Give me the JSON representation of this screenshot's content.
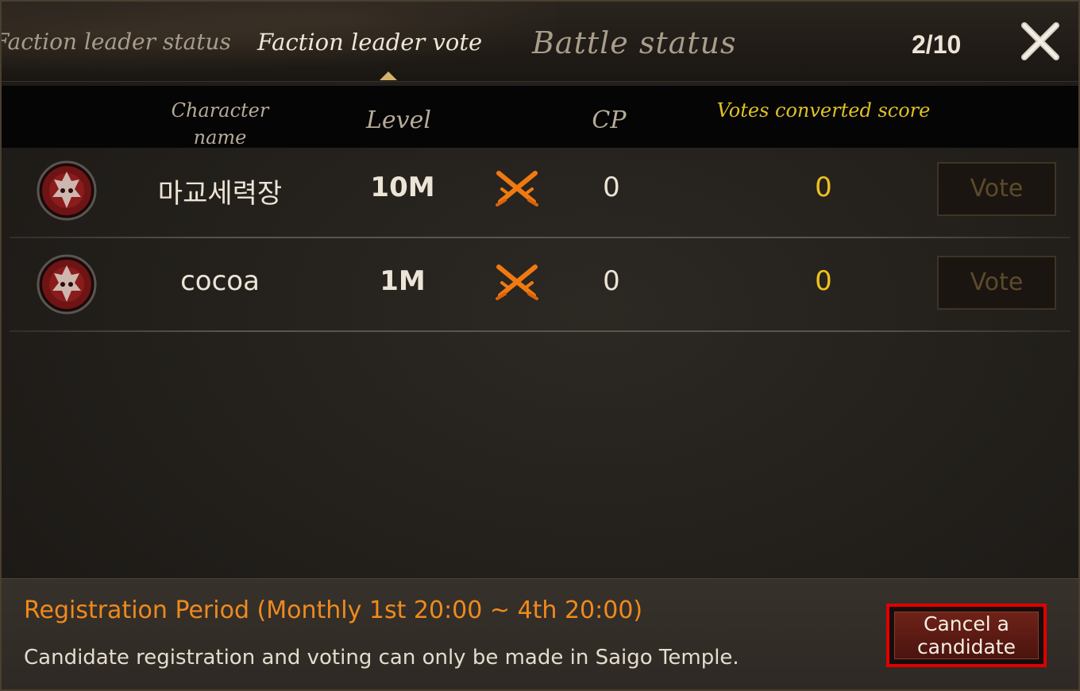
{
  "header": {
    "tabs": [
      {
        "label": "Faction leader status"
      },
      {
        "label": "Faction leader vote"
      },
      {
        "label": "Battle status"
      }
    ],
    "page_count": "2/10"
  },
  "columns": {
    "name": "Character name",
    "level": "Level",
    "cp": "CP",
    "score": "Votes converted score"
  },
  "rows": [
    {
      "name": "마교세력장",
      "level": "10M",
      "cp": "0",
      "score": "0",
      "vote_label": "Vote",
      "avatar_icon": "demon-mask-icon",
      "status_icon": "crossed-swords-icon"
    },
    {
      "name": "cocoa",
      "level": "1M",
      "cp": "0",
      "score": "0",
      "vote_label": "Vote",
      "avatar_icon": "demon-mask-icon",
      "status_icon": "crossed-swords-icon"
    }
  ],
  "footer": {
    "registration_period": "Registration Period (Monthly 1st 20:00 ~ 4th 20:00)",
    "note": "Candidate registration and voting can only be made in Saigo Temple.",
    "cancel_button": "Cancel a candidate"
  },
  "colors": {
    "accent_orange": "#ef8a1e",
    "score_yellow": "#f0c020",
    "highlight_red": "#e00000"
  }
}
